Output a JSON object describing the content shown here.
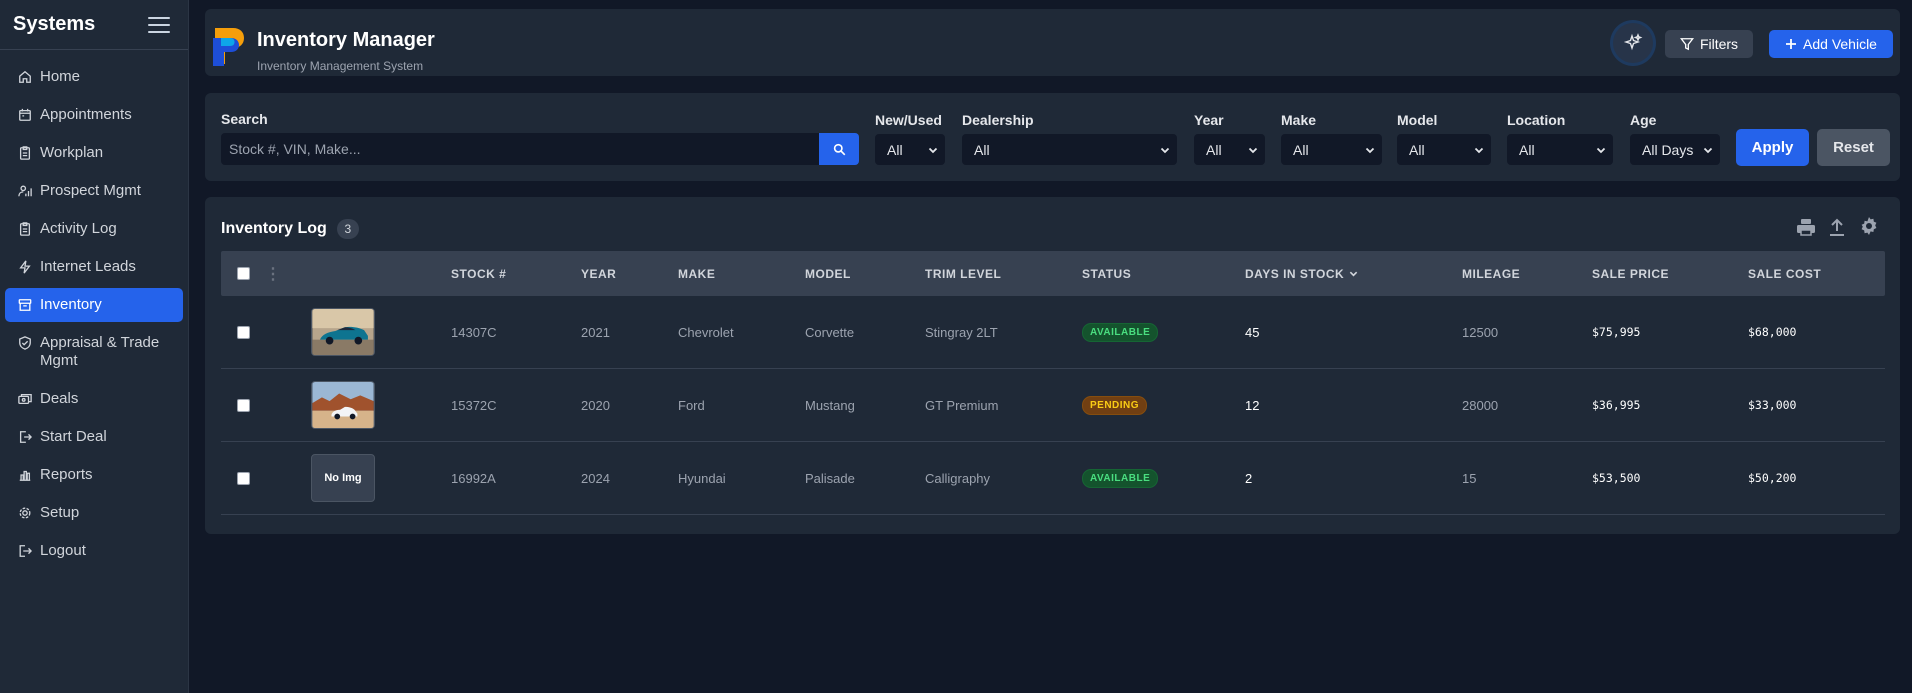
{
  "sidebar": {
    "title": "Systems",
    "items": [
      {
        "label": "Home",
        "icon": "home-icon"
      },
      {
        "label": "Appointments",
        "icon": "calendar-icon"
      },
      {
        "label": "Workplan",
        "icon": "clipboard-icon"
      },
      {
        "label": "Prospect Mgmt",
        "icon": "user-chart-icon"
      },
      {
        "label": "Activity Log",
        "icon": "clipboard-list-icon"
      },
      {
        "label": "Internet Leads",
        "icon": "bolt-icon"
      },
      {
        "label": "Inventory",
        "icon": "archive-icon",
        "active": true
      },
      {
        "label": "Appraisal & Trade Mgmt",
        "icon": "shield-check-icon"
      },
      {
        "label": "Deals",
        "icon": "money-icon"
      },
      {
        "label": "Start Deal",
        "icon": "enter-icon"
      },
      {
        "label": "Reports",
        "icon": "bar-chart-icon"
      },
      {
        "label": "Setup",
        "icon": "gear-icon"
      },
      {
        "label": "Logout",
        "icon": "logout-icon"
      }
    ]
  },
  "header": {
    "title": "Inventory Manager",
    "subtitle": "Inventory Management System",
    "filters_label": "Filters",
    "add_label": "Add Vehicle"
  },
  "filters": {
    "search_label": "Search",
    "search_placeholder": "Stock #, VIN, Make...",
    "new_used": {
      "label": "New/Used",
      "value": "All"
    },
    "dealership": {
      "label": "Dealership",
      "value": "All"
    },
    "year": {
      "label": "Year",
      "value": "All"
    },
    "make": {
      "label": "Make",
      "value": "All"
    },
    "model": {
      "label": "Model",
      "value": "All"
    },
    "location": {
      "label": "Location",
      "value": "All"
    },
    "age": {
      "label": "Age",
      "value": "All Days"
    },
    "apply_label": "Apply",
    "reset_label": "Reset"
  },
  "log": {
    "title": "Inventory Log",
    "count": "3",
    "columns": {
      "stock": "STOCK #",
      "year": "YEAR",
      "make": "MAKE",
      "model": "MODEL",
      "trim": "TRIM LEVEL",
      "status": "STATUS",
      "days": "DAYS IN STOCK",
      "mileage": "MILEAGE",
      "sale_price": "SALE PRICE",
      "sale_cost": "SALE COST"
    },
    "rows": [
      {
        "stock": "14307C",
        "year": "2021",
        "make": "Chevrolet",
        "model": "Corvette",
        "trim": "Stingray 2LT",
        "status": "AVAILABLE",
        "days": "45",
        "mileage": "12500",
        "sale_price": "$75,995",
        "sale_cost": "$68,000",
        "image": "blue-sports-car-photo"
      },
      {
        "stock": "15372C",
        "year": "2020",
        "make": "Ford",
        "model": "Mustang",
        "trim": "GT Premium",
        "status": "PENDING",
        "days": "12",
        "mileage": "28000",
        "sale_price": "$36,995",
        "sale_cost": "$33,000",
        "image": "white-car-desert-photo"
      },
      {
        "stock": "16992A",
        "year": "2024",
        "make": "Hyundai",
        "model": "Palisade",
        "trim": "Calligraphy",
        "status": "AVAILABLE",
        "days": "2",
        "mileage": "15",
        "sale_price": "$53,500",
        "sale_cost": "$50,200",
        "image_text": "No Img"
      }
    ]
  }
}
